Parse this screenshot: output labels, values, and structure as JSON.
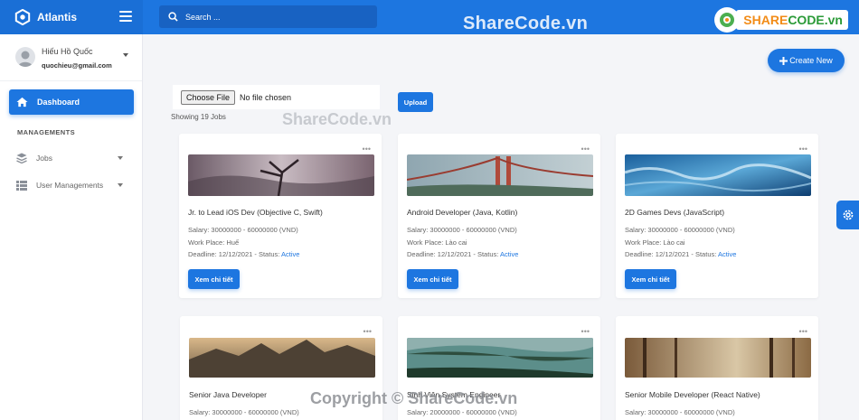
{
  "app": {
    "brand": "Atlantis"
  },
  "search": {
    "placeholder": "Search ..."
  },
  "watermarks": {
    "top": "ShareCode.vn",
    "mid": "ShareCode.vn",
    "bottom": "Copyright © ShareCode.vn",
    "logo_a": "SHARE",
    "logo_b": "CODE.vn"
  },
  "user": {
    "name": "Hiếu Hồ Quốc",
    "email": "quochieu@gmail.com"
  },
  "sidebar": {
    "dashboard": "Dashboard",
    "section": "MANAGEMENTS",
    "items": [
      {
        "label": "Jobs"
      },
      {
        "label": "User Managements"
      }
    ]
  },
  "toolbar": {
    "create_label": "Create New",
    "choose_file": "Choose File",
    "no_file": "No file chosen",
    "upload": "Upload",
    "showing": "Showing 19 Jobs"
  },
  "jobs": [
    {
      "title": "Jr. to Lead iOS Dev (Objective C, Swift)",
      "salary": "Salary: 30000000 - 60000000 (VND)",
      "workplace": "Work Place: Huế",
      "deadline": "Deadline: 12/12/2021 - Status: ",
      "status": "Active",
      "button": "Xem chi tiết"
    },
    {
      "title": "Android Developer (Java, Kotlin)",
      "salary": "Salary: 30000000 - 60000000 (VND)",
      "workplace": "Work Place: Lào cai",
      "deadline": "Deadline: 12/12/2021 - Status: ",
      "status": "Active",
      "button": "Xem chi tiết"
    },
    {
      "title": "2D Games Devs (JavaScript)",
      "salary": "Salary: 30000000 - 60000000 (VND)",
      "workplace": "Work Place: Lào cai",
      "deadline": "Deadline: 12/12/2021 - Status: ",
      "status": "Active",
      "button": "Xem chi tiết"
    },
    {
      "title": "Senior Java Developer",
      "salary": "Salary: 30000000 - 60000000 (VND)"
    },
    {
      "title": "Sinh Viên System Engineer",
      "salary": "Salary: 20000000 - 60000000 (VND)"
    },
    {
      "title": "Senior Mobile Developer (React Native)",
      "salary": "Salary: 30000000 - 60000000 (VND)"
    }
  ],
  "colors": {
    "primary": "#1d76e0",
    "sidebar_bg": "#ffffff",
    "page_bg": "#f4f5f8"
  },
  "icons": [
    "logo-icon",
    "hamburger-icon",
    "search-icon",
    "home-icon",
    "layers-icon",
    "table-icon",
    "plus-icon",
    "more-dots-icon",
    "gear-icon"
  ]
}
